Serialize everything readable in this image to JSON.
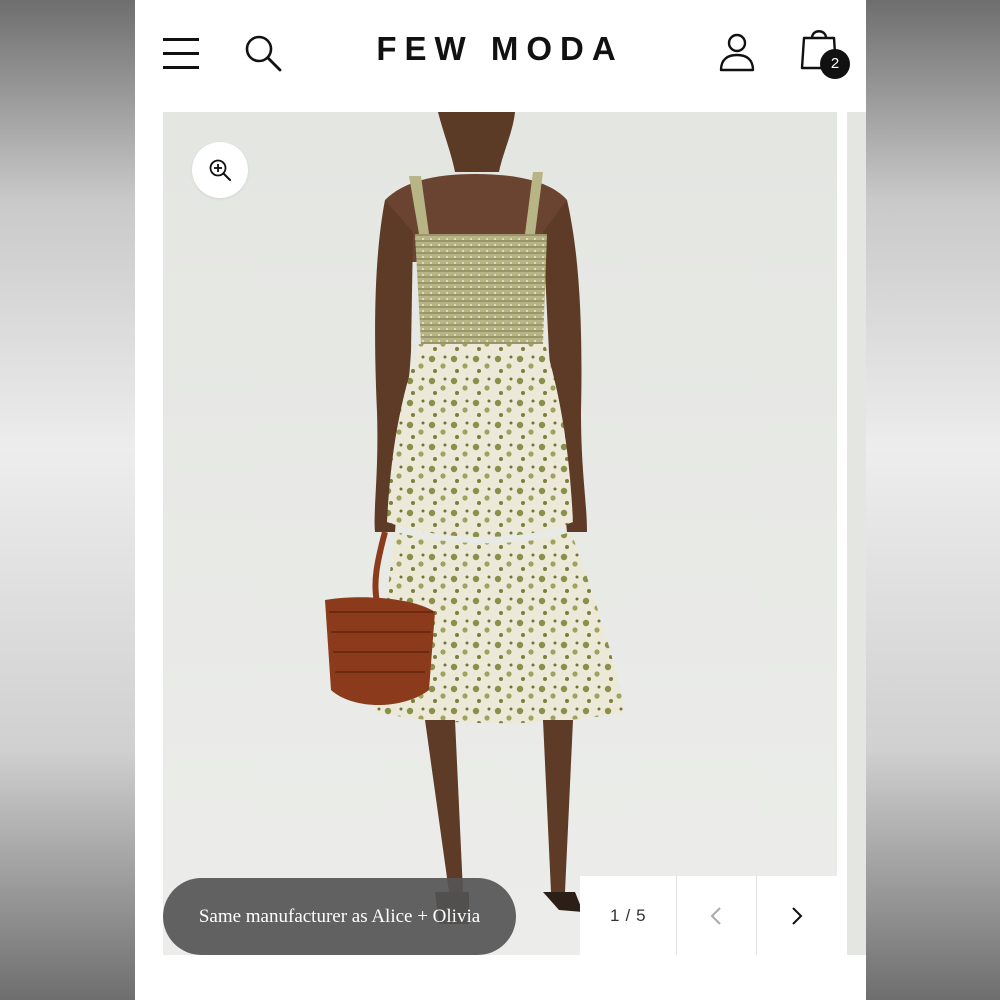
{
  "header": {
    "brand": "FEW MODA",
    "cart_count": "2"
  },
  "gallery": {
    "caption": "Same manufacturer as Alice + Olivia",
    "pager": {
      "current": "1",
      "separator": "/",
      "total": "5"
    },
    "image_alt": "Model wearing a tiered green floral smocked midi dress carrying a woven brown basket"
  },
  "colors": {
    "page_bg": "#ffffff",
    "text": "#111111",
    "photo_bg": "#e6e8e4",
    "dress_green": "#8a8f4a",
    "basket_brown": "#8b3a1c",
    "caption_bg": "#555555"
  },
  "icons": [
    "menu-icon",
    "search-icon",
    "account-icon",
    "shopping-bag-icon",
    "zoom-in-icon",
    "chevron-left-icon",
    "chevron-right-icon"
  ]
}
